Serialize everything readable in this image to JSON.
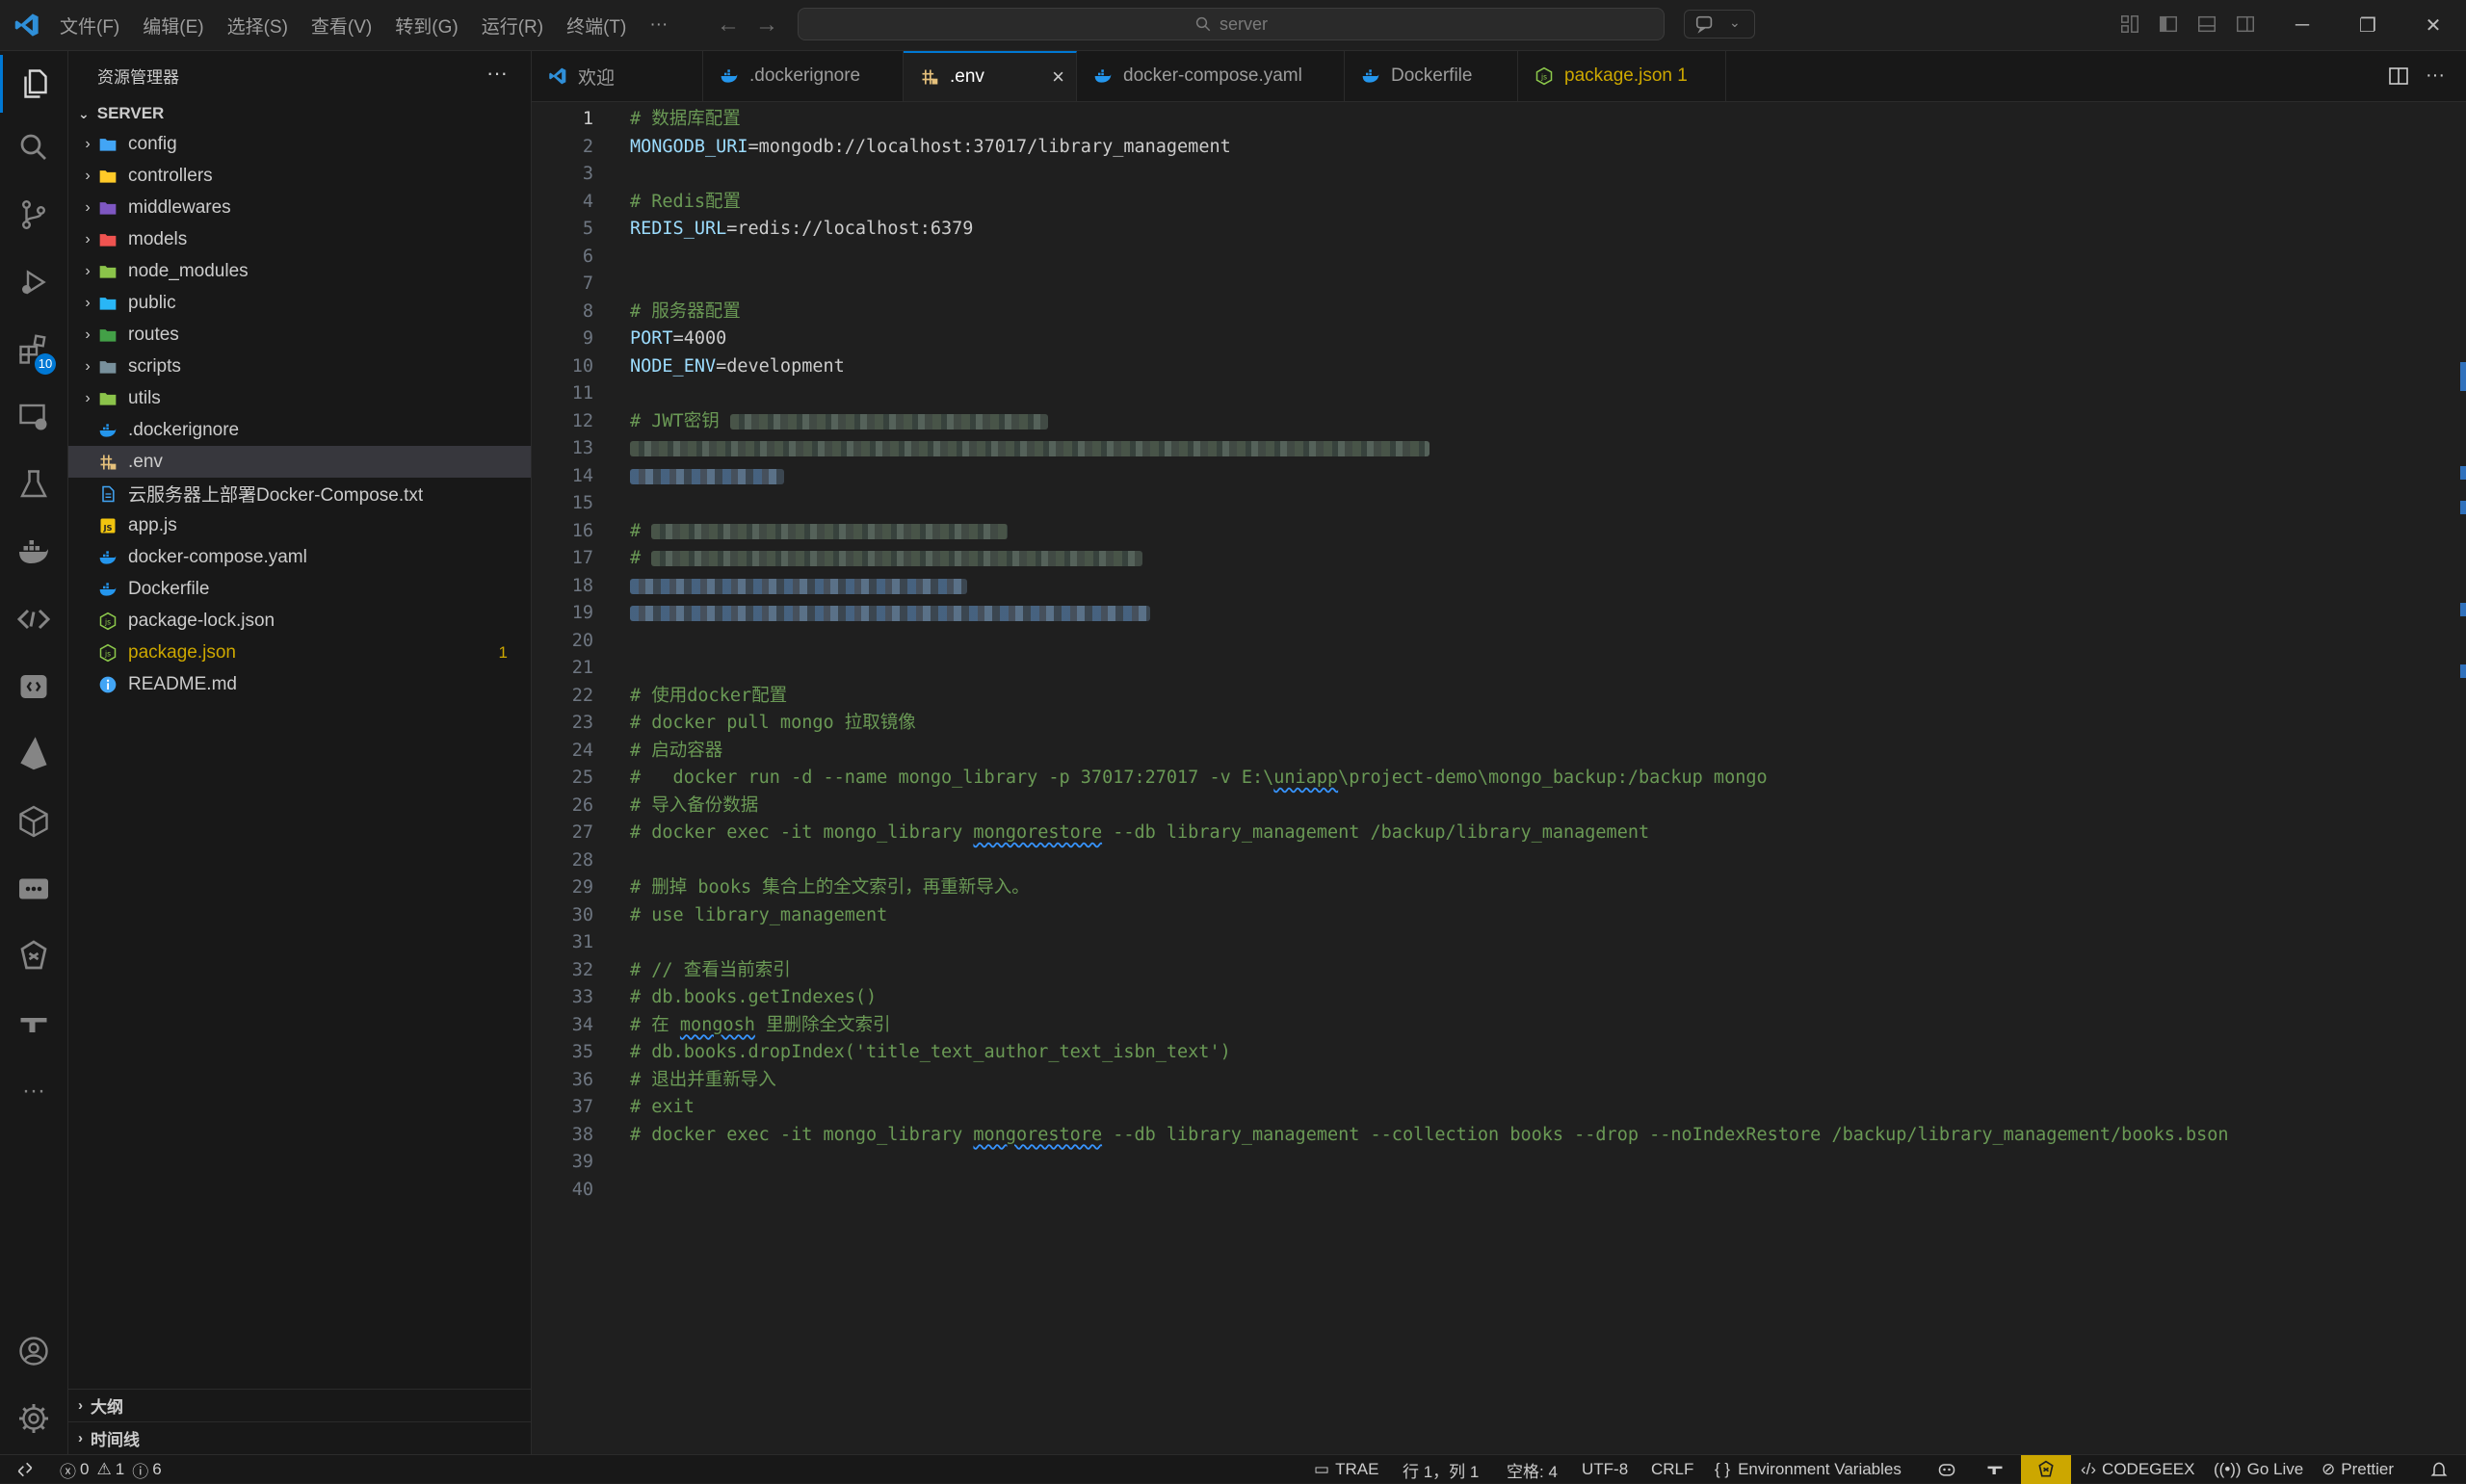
{
  "titlebar": {
    "menus": [
      "文件(F)",
      "编辑(E)",
      "选择(S)",
      "查看(V)",
      "转到(G)",
      "运行(R)",
      "终端(T)",
      "···"
    ],
    "search": "server"
  },
  "activity": {
    "extensions_badge": "10",
    "more": "···"
  },
  "sidebar": {
    "title": "资源管理器",
    "more": "···",
    "section": "SERVER",
    "items": [
      {
        "label": "config",
        "folder": true,
        "color": "#42a5f5"
      },
      {
        "label": "controllers",
        "folder": true,
        "color": "#ffca28"
      },
      {
        "label": "middlewares",
        "folder": true,
        "color": "#7e57c2"
      },
      {
        "label": "models",
        "folder": true,
        "color": "#ef5350"
      },
      {
        "label": "node_modules",
        "folder": true,
        "color": "#8bc34a"
      },
      {
        "label": "public",
        "folder": true,
        "color": "#29b6f6"
      },
      {
        "label": "routes",
        "folder": true,
        "color": "#43a047"
      },
      {
        "label": "scripts",
        "folder": true,
        "color": "#78909c"
      },
      {
        "label": "utils",
        "folder": true,
        "color": "#8bc34a"
      },
      {
        "label": ".dockerignore",
        "folder": false,
        "icon": "docker-icon"
      },
      {
        "label": ".env",
        "folder": false,
        "icon": "env-icon",
        "selected": true
      },
      {
        "label": "云服务器上部署Docker-Compose.txt",
        "folder": false,
        "icon": "text-file-icon"
      },
      {
        "label": "app.js",
        "folder": false,
        "icon": "js-icon"
      },
      {
        "label": "docker-compose.yaml",
        "folder": false,
        "icon": "docker-icon"
      },
      {
        "label": "Dockerfile",
        "folder": false,
        "icon": "docker-icon"
      },
      {
        "label": "package-lock.json",
        "folder": false,
        "icon": "node-icon"
      },
      {
        "label": "package.json",
        "folder": false,
        "icon": "node-icon",
        "warn": true,
        "count": "1"
      },
      {
        "label": "README.md",
        "folder": false,
        "icon": "info-icon"
      }
    ],
    "outline": "大纲",
    "timeline": "时间线"
  },
  "tabs": [
    {
      "label": "欢迎",
      "icon": "vscode-icon"
    },
    {
      "label": ".dockerignore",
      "icon": "docker-icon"
    },
    {
      "label": ".env",
      "icon": "env-icon",
      "active": true,
      "close": "×"
    },
    {
      "label": "docker-compose.yaml",
      "icon": "docker-icon"
    },
    {
      "label": "Dockerfile",
      "icon": "docker-icon"
    },
    {
      "label": "package.json 1",
      "icon": "node-icon",
      "warn": true
    }
  ],
  "editor": {
    "lines": [
      {
        "n": "1",
        "segs": [
          {
            "t": "# 数据库配置",
            "c": "c"
          }
        ]
      },
      {
        "n": "2",
        "segs": [
          {
            "t": "MONGODB_URI",
            "c": "k"
          },
          {
            "t": "=mongodb://localhost:37017/library_management",
            "c": "v"
          }
        ]
      },
      {
        "n": "3",
        "segs": []
      },
      {
        "n": "4",
        "segs": [
          {
            "t": "# Redis配置",
            "c": "c"
          }
        ]
      },
      {
        "n": "5",
        "segs": [
          {
            "t": "REDIS_URL",
            "c": "k"
          },
          {
            "t": "=redis://localhost:6379",
            "c": "v"
          }
        ]
      },
      {
        "n": "6",
        "segs": []
      },
      {
        "n": "7",
        "segs": []
      },
      {
        "n": "8",
        "segs": [
          {
            "t": "# 服务器配置",
            "c": "c"
          }
        ]
      },
      {
        "n": "9",
        "segs": [
          {
            "t": "PORT",
            "c": "k"
          },
          {
            "t": "=4000",
            "c": "v"
          }
        ]
      },
      {
        "n": "10",
        "segs": [
          {
            "t": "NODE_ENV",
            "c": "k"
          },
          {
            "t": "=development",
            "c": "v"
          }
        ]
      },
      {
        "n": "11",
        "segs": []
      },
      {
        "n": "12",
        "segs": [
          {
            "t": "# JWT密钥 ",
            "c": "c"
          }
        ],
        "blur": 330
      },
      {
        "n": "13",
        "segs": [],
        "blur": 830,
        "blurblue": false
      },
      {
        "n": "14",
        "segs": [],
        "blur": 160,
        "blurblue": true
      },
      {
        "n": "15",
        "segs": []
      },
      {
        "n": "16",
        "segs": [
          {
            "t": "# ",
            "c": "c"
          }
        ],
        "blur": 370
      },
      {
        "n": "17",
        "segs": [
          {
            "t": "# ",
            "c": "c"
          }
        ],
        "blur": 510
      },
      {
        "n": "18",
        "segs": [],
        "blur": 350,
        "blurblue": true
      },
      {
        "n": "19",
        "segs": [],
        "blur": 540,
        "blurblue": true
      },
      {
        "n": "20",
        "segs": []
      },
      {
        "n": "21",
        "segs": []
      },
      {
        "n": "22",
        "segs": [
          {
            "t": "# 使用docker配置",
            "c": "c"
          }
        ]
      },
      {
        "n": "23",
        "segs": [
          {
            "t": "# docker pull mongo 拉取镜像",
            "c": "c"
          }
        ]
      },
      {
        "n": "24",
        "segs": [
          {
            "t": "# 启动容器",
            "c": "c"
          }
        ]
      },
      {
        "n": "25",
        "segs": [
          {
            "t": "#   docker run -d --name mongo_library -p 37017:27017 -v E:\\",
            "c": "c"
          },
          {
            "t": "uniapp",
            "c": "c",
            "sq": true
          },
          {
            "t": "\\project-demo\\mongo_backup:/backup mongo",
            "c": "c"
          }
        ]
      },
      {
        "n": "26",
        "segs": [
          {
            "t": "# 导入备份数据",
            "c": "c"
          }
        ]
      },
      {
        "n": "27",
        "segs": [
          {
            "t": "# docker exec -it mongo_library ",
            "c": "c"
          },
          {
            "t": "mongorestore",
            "c": "c",
            "sq": true
          },
          {
            "t": " --db library_management /backup/library_management",
            "c": "c"
          }
        ]
      },
      {
        "n": "28",
        "segs": []
      },
      {
        "n": "29",
        "segs": [
          {
            "t": "# 删掉 books 集合上的全文索引，再重新导入。",
            "c": "c"
          }
        ]
      },
      {
        "n": "30",
        "segs": [
          {
            "t": "# use library_management",
            "c": "c"
          }
        ]
      },
      {
        "n": "31",
        "segs": []
      },
      {
        "n": "32",
        "segs": [
          {
            "t": "# // 查看当前索引",
            "c": "c"
          }
        ]
      },
      {
        "n": "33",
        "segs": [
          {
            "t": "# db.books.getIndexes()",
            "c": "c"
          }
        ]
      },
      {
        "n": "34",
        "segs": [
          {
            "t": "# 在 ",
            "c": "c"
          },
          {
            "t": "mongosh",
            "c": "c",
            "sq": true
          },
          {
            "t": " 里删除全文索引",
            "c": "c"
          }
        ]
      },
      {
        "n": "35",
        "segs": [
          {
            "t": "# db.books.dropIndex('title_text_author_text_isbn_text')",
            "c": "c"
          }
        ]
      },
      {
        "n": "36",
        "segs": [
          {
            "t": "# 退出并重新导入",
            "c": "c"
          }
        ]
      },
      {
        "n": "37",
        "segs": [
          {
            "t": "# exit",
            "c": "c"
          }
        ]
      },
      {
        "n": "38",
        "segs": [
          {
            "t": "# docker exec -it mongo_library ",
            "c": "c"
          },
          {
            "t": "mongorestore",
            "c": "c",
            "sq": true
          },
          {
            "t": " --db library_management --collection books --drop --noIndexRestore /backup/library_management/books.bson",
            "c": "c"
          }
        ]
      },
      {
        "n": "39",
        "segs": []
      },
      {
        "n": "40",
        "segs": []
      }
    ]
  },
  "statusbar": {
    "errors": "0",
    "warnings": "1",
    "info": "6",
    "trae": "TRAE",
    "position": "行 1，列 1",
    "spaces": "空格: 4",
    "encoding": "UTF-8",
    "eol": "CRLF",
    "language": "Environment Variables",
    "codegeex": "CODEGEEX",
    "golive": "Go Live",
    "prettier": "Prettier"
  },
  "colors": {
    "accent": "#0078d4",
    "warning": "#cca700",
    "comment": "#6a9955",
    "variable": "#9cdcfe"
  }
}
